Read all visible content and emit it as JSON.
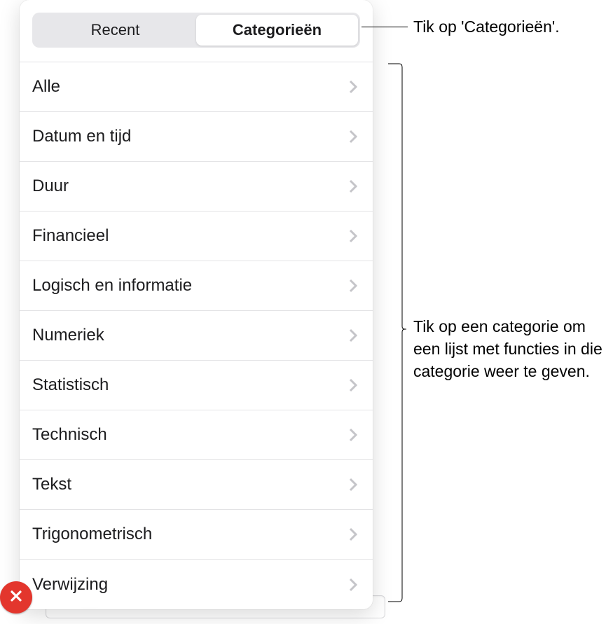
{
  "tabs": {
    "recent": "Recent",
    "categories": "Categorieën"
  },
  "categories": [
    "Alle",
    "Datum en tijd",
    "Duur",
    "Financieel",
    "Logisch en informatie",
    "Numeriek",
    "Statistisch",
    "Technisch",
    "Tekst",
    "Trigonometrisch",
    "Verwijzing"
  ],
  "callouts": {
    "top": "Tik op 'Categorieën'.",
    "middle": "Tik op een categorie om een lijst met functies in die categorie weer te geven."
  }
}
